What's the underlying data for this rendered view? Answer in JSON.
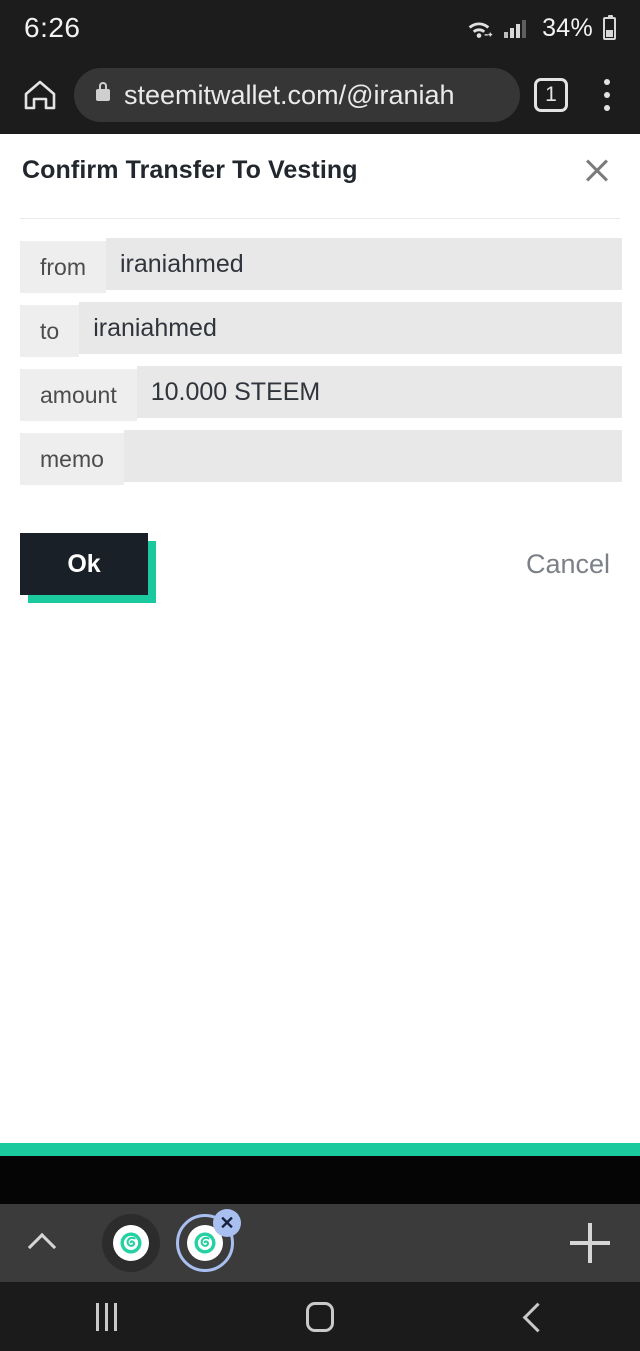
{
  "status_bar": {
    "time": "6:26",
    "wifi_icon": "wifi-icon",
    "signal_icon": "cellular-signal-icon",
    "battery_percent": "34%",
    "battery_icon": "battery-icon"
  },
  "browser": {
    "home_icon": "home-icon",
    "lock_icon": "lock-icon",
    "url": "steemitwallet.com/@iraniah",
    "tab_count": "1",
    "menu_icon": "kebab-menu-icon"
  },
  "dialog": {
    "title": "Confirm Transfer To Vesting",
    "close_icon": "close-icon",
    "fields": [
      {
        "label": "from",
        "value": "iraniahmed"
      },
      {
        "label": "to",
        "value": "iraniahmed"
      },
      {
        "label": "amount",
        "value": "10.000 STEEM"
      },
      {
        "label": "memo",
        "value": ""
      }
    ],
    "ok_label": "Ok",
    "cancel_label": "Cancel"
  },
  "footer": {
    "line1": "",
    "line2": ""
  },
  "tab_strip": {
    "expand_icon": "chevron-up-icon",
    "tabs": [
      {
        "name": "tab-steemit-1",
        "favicon": "steemit-favicon",
        "selected": false
      },
      {
        "name": "tab-steemit-2",
        "favicon": "steemit-favicon",
        "selected": true
      }
    ],
    "close_tab_icon": "close-tab-icon",
    "new_tab_icon": "plus-icon"
  },
  "nav_bar": {
    "recents_icon": "recents-icon",
    "home_icon": "home-square-icon",
    "back_icon": "back-chevron-icon"
  },
  "colors": {
    "accent_teal": "#1bc99f",
    "button_dark": "#1a2028",
    "chrome_dark": "#1c1c1c",
    "field_gray": "#e8e8e8",
    "label_gray": "#eeeeee",
    "tab_ring_blue": "#a9bff0"
  }
}
